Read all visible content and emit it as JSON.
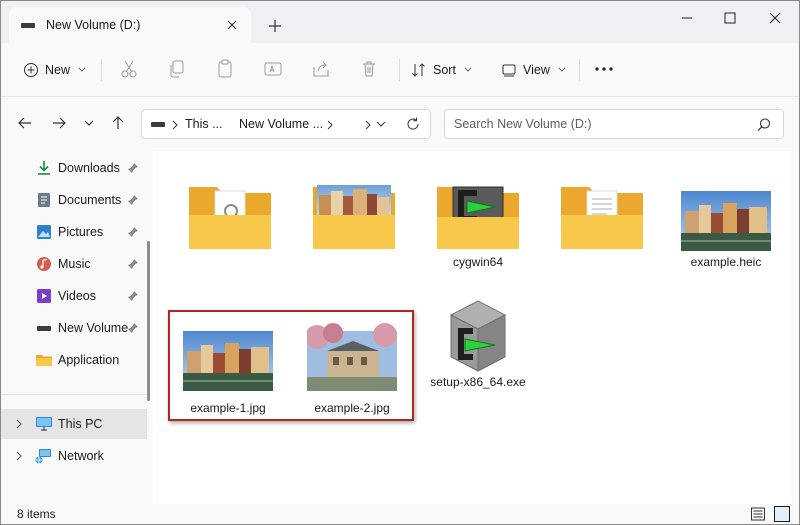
{
  "window": {
    "tab_title": "New Volume (D:)"
  },
  "toolbar": {
    "new_label": "New",
    "sort_label": "Sort",
    "view_label": "View"
  },
  "address": {
    "crumb1": "This ...",
    "crumb2": "New Volume ..."
  },
  "search": {
    "placeholder": "Search New Volume (D:)"
  },
  "sidebar": {
    "items": [
      {
        "label": "Downloads",
        "pinned": true
      },
      {
        "label": "Documents",
        "pinned": true
      },
      {
        "label": "Pictures",
        "pinned": true
      },
      {
        "label": "Music",
        "pinned": true
      },
      {
        "label": "Videos",
        "pinned": true
      },
      {
        "label": "New Volume",
        "pinned": true
      },
      {
        "label": "Application",
        "pinned": false
      }
    ],
    "this_pc": "This PC",
    "network": "Network"
  },
  "files": [
    {
      "name": "",
      "kind": "folder",
      "preview": "document-gear"
    },
    {
      "name": "",
      "kind": "folder",
      "preview": "photo"
    },
    {
      "name": "cygwin64",
      "kind": "folder",
      "preview": "cygwin-logo"
    },
    {
      "name": "",
      "kind": "folder",
      "preview": "document"
    },
    {
      "name": "example.heic",
      "kind": "image"
    },
    {
      "name": "example-1.jpg",
      "kind": "image",
      "selected": true
    },
    {
      "name": "example-2.jpg",
      "kind": "image",
      "selected": true
    },
    {
      "name": "setup-x86_64.exe",
      "kind": "application"
    }
  ],
  "status": {
    "item_count": "8 items"
  },
  "colors": {
    "folder": "#f8c84b",
    "folder_back": "#eaa92c",
    "selection_box": "#b3261e",
    "accent": "#0067c0"
  }
}
